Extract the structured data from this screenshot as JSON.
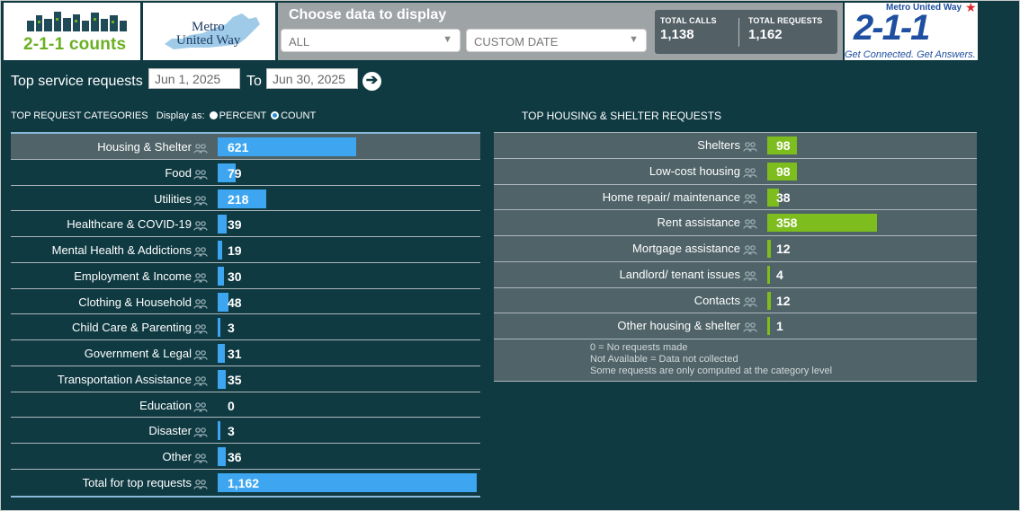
{
  "header": {
    "logo_left_text": "2-1-1 counts",
    "logo_mid_line1": "Metro",
    "logo_mid_line2": "United Way",
    "choose_title": "Choose data to display",
    "area_select": "ALL",
    "date_select": "CUSTOM DATE",
    "total_calls_label": "TOTAL CALLS",
    "total_calls": "1,138",
    "total_requests_label": "TOTAL REQUESTS",
    "total_requests": "1,162",
    "logo_right_top": "Metro United Way",
    "logo_right_big": "2-1-1",
    "logo_right_tagline": "Get Connected. Get Answers."
  },
  "date_filter": {
    "label": "Top service requests",
    "from": "Jun 1, 2025",
    "to_label": "To",
    "to": "Jun 30, 2025"
  },
  "left": {
    "title": "TOP REQUEST CATEGORIES",
    "display_as": "Display as:",
    "option_percent": "PERCENT",
    "option_count": "COUNT",
    "selected_option": "COUNT",
    "max_value": 1162,
    "rows": [
      {
        "name": "Housing & Shelter",
        "value": 621
      },
      {
        "name": "Food",
        "value": 79
      },
      {
        "name": "Utilities",
        "value": 218
      },
      {
        "name": "Healthcare & COVID-19",
        "value": 39
      },
      {
        "name": "Mental Health & Addictions",
        "value": 19
      },
      {
        "name": "Employment & Income",
        "value": 30
      },
      {
        "name": "Clothing & Household",
        "value": 48
      },
      {
        "name": "Child Care & Parenting",
        "value": 3
      },
      {
        "name": "Government & Legal",
        "value": 31
      },
      {
        "name": "Transportation Assistance",
        "value": 35
      },
      {
        "name": "Education",
        "value": 0
      },
      {
        "name": "Disaster",
        "value": 3
      },
      {
        "name": "Other",
        "value": 36
      },
      {
        "name": "Total for top requests",
        "value": "1,162",
        "amount": 1162
      }
    ]
  },
  "right": {
    "title": "TOP HOUSING & SHELTER REQUESTS",
    "max_value": 1162,
    "rows": [
      {
        "name": "Shelters",
        "value": 98
      },
      {
        "name": "Low-cost housing",
        "value": 98
      },
      {
        "name": "Home repair/ maintenance",
        "value": 38
      },
      {
        "name": "Rent assistance",
        "value": 358
      },
      {
        "name": "Mortgage assistance",
        "value": 12
      },
      {
        "name": "Landlord/ tenant issues",
        "value": 4
      },
      {
        "name": "Contacts",
        "value": 12
      },
      {
        "name": "Other housing & shelter",
        "value": 1
      }
    ],
    "notes": [
      "0 = No requests made",
      "Not Available = Data not collected",
      "Some requests are only computed at the category level"
    ]
  },
  "colors": {
    "background": "#0f3a42",
    "left_bar": "#3ea6f0",
    "right_bar": "#7dbd1d",
    "highlight_row": "#4f6368"
  }
}
